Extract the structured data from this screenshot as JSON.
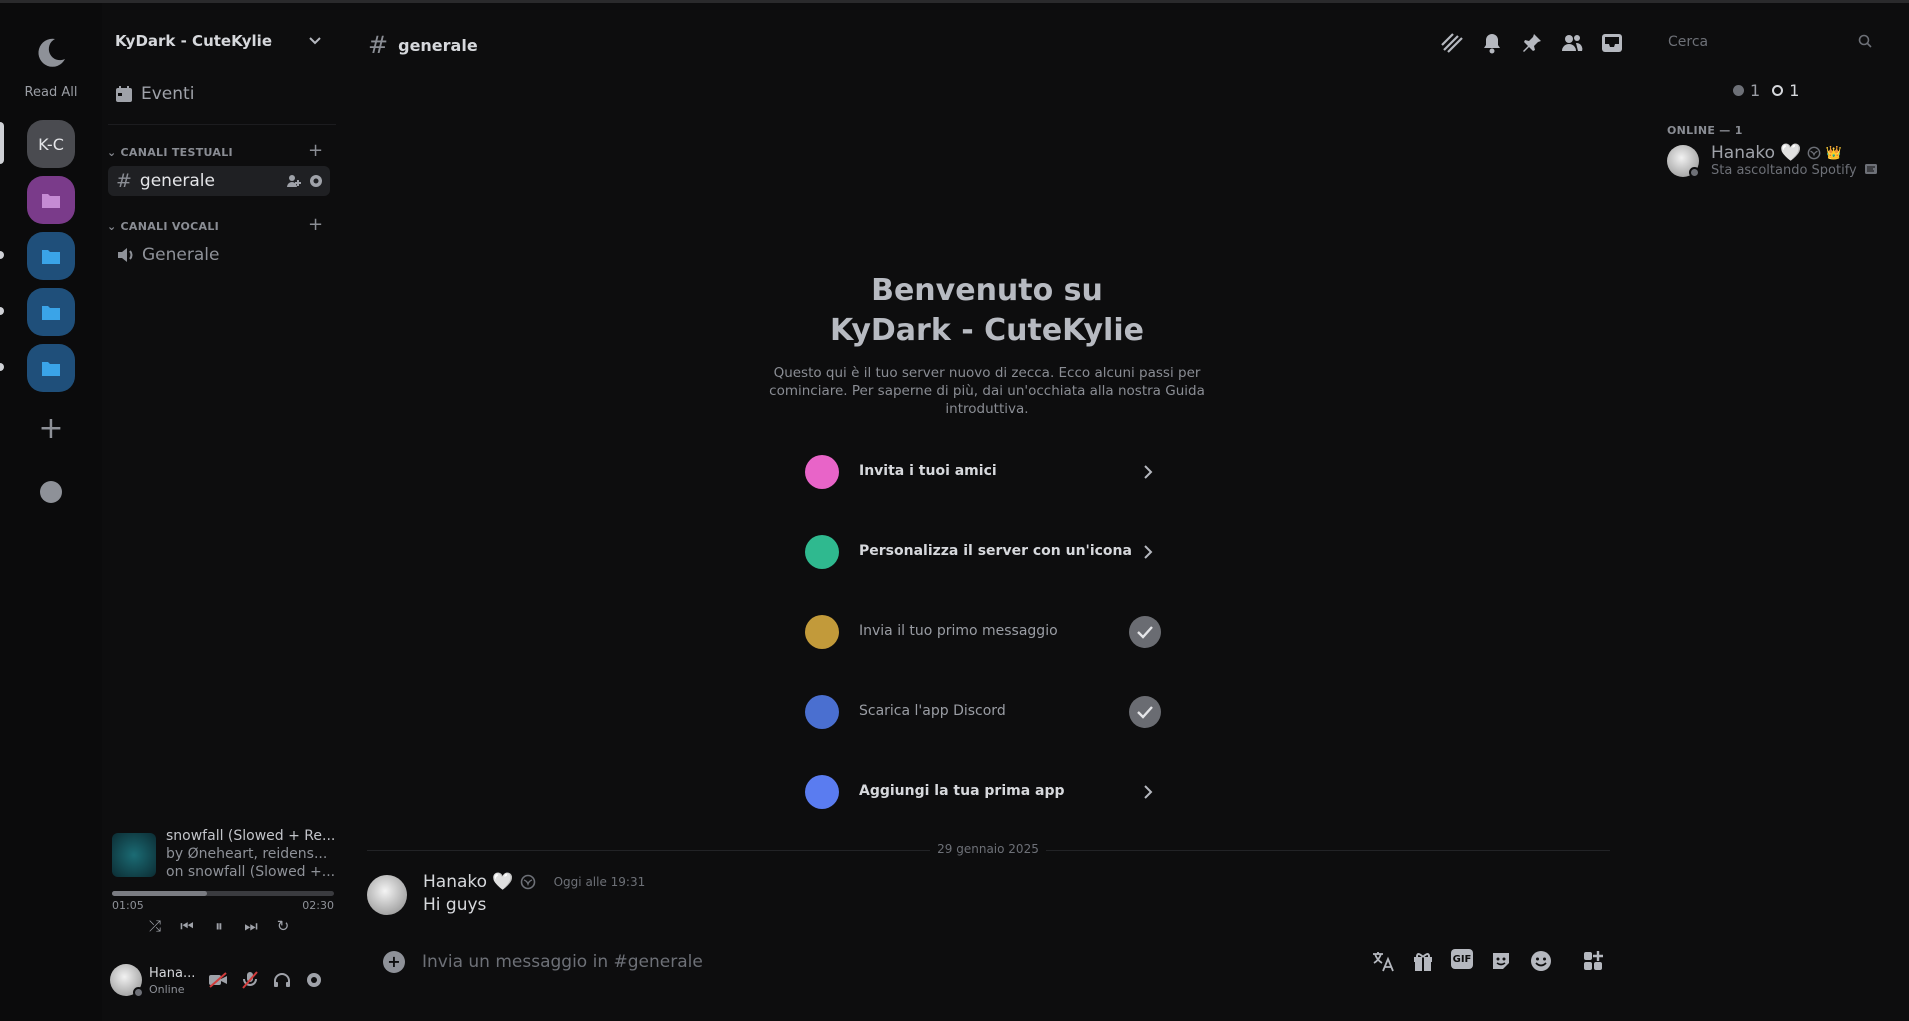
{
  "rail": {
    "read_all": "Read All",
    "server_kc": "K-C"
  },
  "guild": {
    "name": "KyDark - CuteKylie",
    "events": "Eventi"
  },
  "categories": {
    "text": "CANALI TESTUALI",
    "voice": "CANALI VOCALI"
  },
  "channels": {
    "text_active": "generale",
    "voice": "Generale"
  },
  "player": {
    "title": "snowfall (Slowed + Re...",
    "artist": "by Øneheart, reidens...",
    "album": "on snowfall (Slowed +...",
    "elapsed": "01:05",
    "duration": "02:30",
    "progress": 0.43
  },
  "user": {
    "name": "Hana...",
    "status": "Online"
  },
  "header": {
    "channel": "generale",
    "search_placeholder": "Cerca"
  },
  "welcome": {
    "title_line1": "Benvenuto su",
    "title_line2": "KyDark - CuteKylie",
    "description": "Questo qui è il tuo server nuovo di zecca. Ecco alcuni passi per cominciare. Per saperne di più, dai un'occhiata alla nostra Guida introduttiva.",
    "steps": [
      {
        "label": "Invita i tuoi amici",
        "done": false,
        "color": "#e864c8"
      },
      {
        "label": "Personalizza il server con un'icona",
        "done": false,
        "color": "#2fb98f"
      },
      {
        "label": "Invia il tuo primo messaggio",
        "done": true,
        "color": "#c29a3a"
      },
      {
        "label": "Scarica l'app Discord",
        "done": true,
        "color": "#4a6fd0"
      },
      {
        "label": "Aggiungi la tua prima app",
        "done": false,
        "color": "#5a7cf0"
      }
    ]
  },
  "divider_date": "29 gennaio 2025",
  "message": {
    "author": "Hanako 🤍",
    "time": "Oggi alle 19:31",
    "text": "Hi guys"
  },
  "composer": {
    "placeholder": "Invia un messaggio in #generale",
    "gif_label": "GIF"
  },
  "members": {
    "count_a": "1",
    "count_b": "1",
    "online_header": "ONLINE — 1",
    "member_name": "Hanako 🤍",
    "member_activity": "Sta ascoltando Spotify"
  },
  "colors": {
    "background": "#0d0d0e",
    "folder_blue": "#1f4f7a",
    "folder_purple": "#7a3b8a",
    "check_grey": "#6a6c72"
  }
}
